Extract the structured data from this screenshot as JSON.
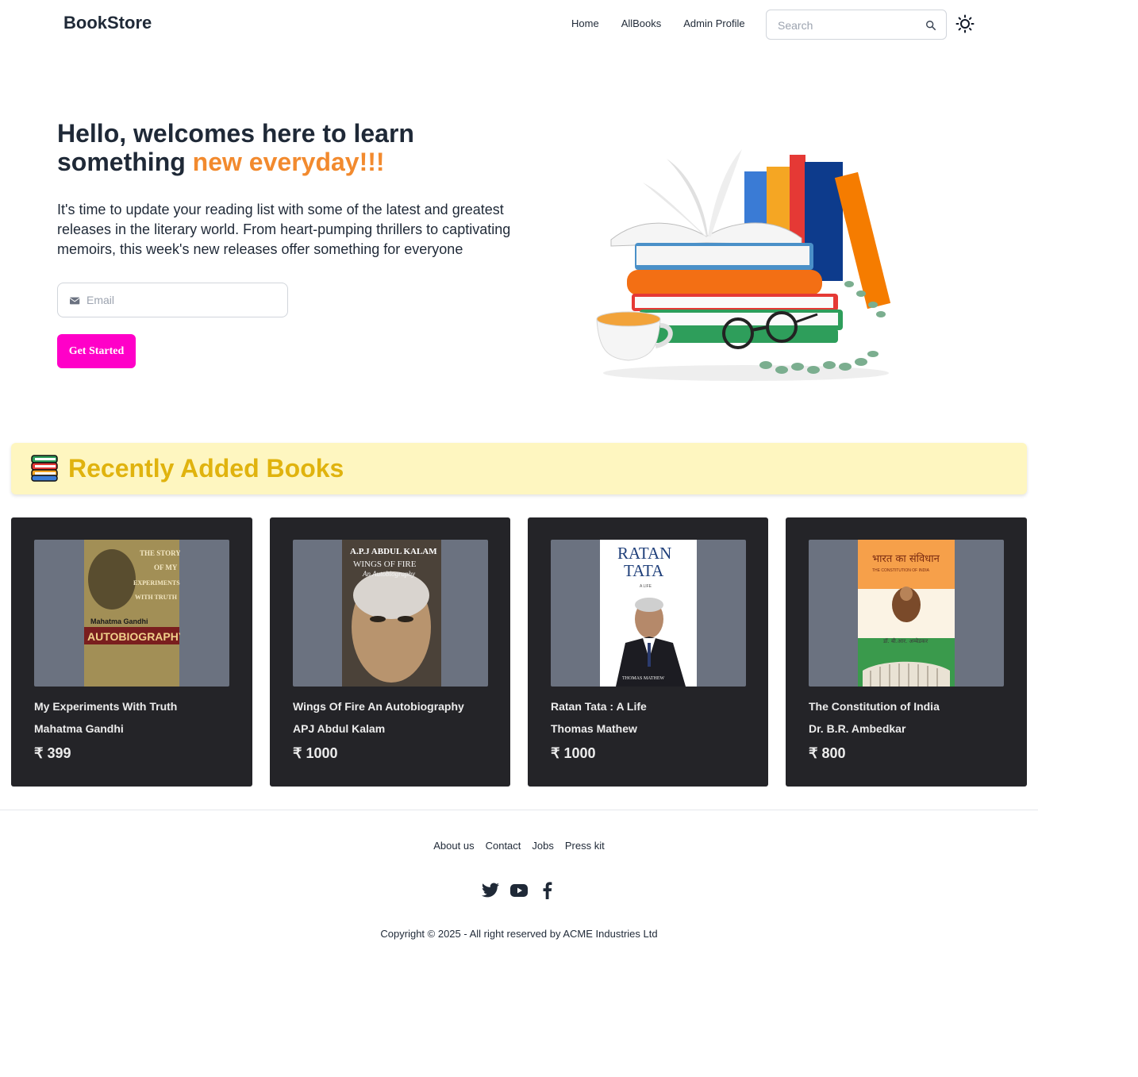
{
  "navbar": {
    "brand": "BookStore",
    "links": [
      "Home",
      "AllBooks",
      "Admin Profile"
    ],
    "search_placeholder": "Search",
    "theme_icon": "sun-icon"
  },
  "hero": {
    "title_main": "Hello, welcomes here to learn something ",
    "title_accent": "new everyday!!!",
    "description": "It's time to update your reading list with some of the latest and greatest releases in the literary world. From heart-pumping thrillers to captivating memoirs, this week's new releases offer something for everyone",
    "email_placeholder": "Email",
    "cta_label": "Get Started"
  },
  "section": {
    "title": "Recently Added Books"
  },
  "books": [
    {
      "title": "My Experiments With Truth",
      "author": "Mahatma Gandhi",
      "price": "₹ 399",
      "cover_text": [
        "THE STORY",
        "OF MY",
        "EXPERIMENTS",
        "WITH TRUTH",
        "Mahatma Gandhi",
        "AUTOBIOGRAPHY"
      ]
    },
    {
      "title": "Wings Of Fire An Autobiography",
      "author": "APJ Abdul Kalam",
      "price": "₹ 1000",
      "cover_text": [
        "A.P.J ABDUL KALAM",
        "WINGS OF FIRE",
        "An Autobiography"
      ]
    },
    {
      "title": "Ratan Tata : A Life",
      "author": "Thomas Mathew",
      "price": "₹ 1000",
      "cover_text": [
        "RATAN",
        "TATA",
        "A LIFE",
        "THOMAS MATHEW"
      ]
    },
    {
      "title": "The Constitution of India",
      "author": "Dr. B.R. Ambedkar",
      "price": "₹ 800",
      "cover_text": [
        "भारत का संविधान",
        "THE CONSTITUTION OF INDIA",
        "डॉ. बी.आर. अम्बेडकर"
      ]
    }
  ],
  "footer": {
    "links": [
      "About us",
      "Contact",
      "Jobs",
      "Press kit"
    ],
    "social": [
      "twitter-icon",
      "youtube-icon",
      "facebook-icon"
    ],
    "copyright": "Copyright © 2025 - All right reserved by ACME Industries Ltd"
  },
  "colors": {
    "accent_orange": "#f28a2e",
    "cta_pink": "#ff00c8",
    "section_bg": "#fef6c0",
    "section_title": "#e0b30e",
    "card_bg": "#242428"
  }
}
